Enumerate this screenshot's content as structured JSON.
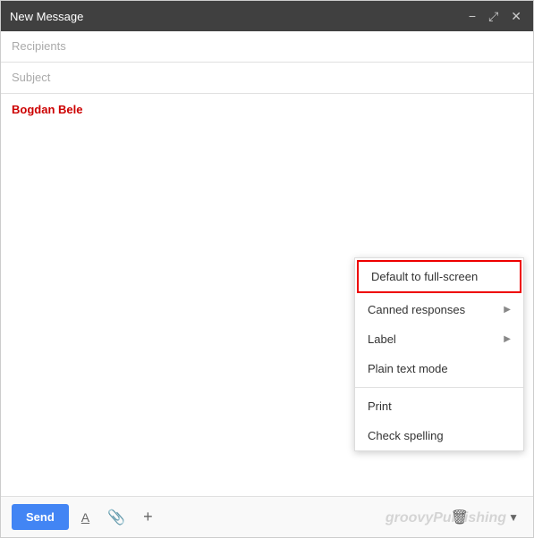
{
  "titleBar": {
    "title": "New Message",
    "minimizeLabel": "−",
    "expandLabel": "⤢",
    "closeLabel": "✕"
  },
  "fields": {
    "recipientsPlaceholder": "Recipients",
    "subjectPlaceholder": "Subject"
  },
  "body": {
    "senderName": "Bogdan Bele"
  },
  "toolbar": {
    "sendLabel": "Send",
    "formatIcon": "A",
    "attachIcon": "📎",
    "moreIcon": "+"
  },
  "dropdown": {
    "items": [
      {
        "label": "Default to full-screen",
        "highlighted": true,
        "hasArrow": false
      },
      {
        "label": "Canned responses",
        "highlighted": false,
        "hasArrow": true
      },
      {
        "label": "Label",
        "highlighted": false,
        "hasArrow": true
      },
      {
        "label": "Plain text mode",
        "highlighted": false,
        "hasArrow": false
      },
      {
        "label": "Print",
        "highlighted": false,
        "hasArrow": false
      },
      {
        "label": "Check spelling",
        "highlighted": false,
        "hasArrow": false
      }
    ]
  },
  "watermark": {
    "text": "groovyPublishing"
  }
}
